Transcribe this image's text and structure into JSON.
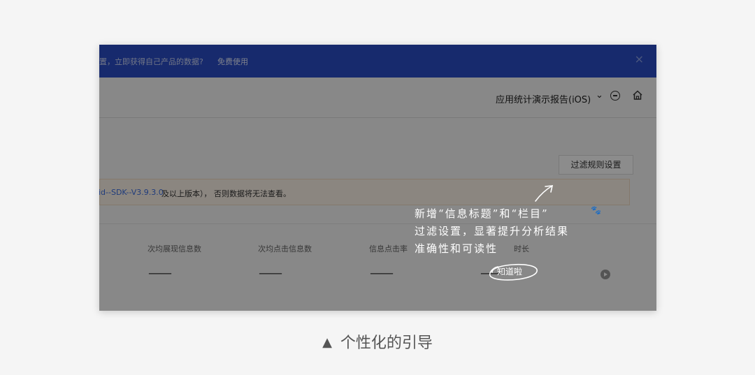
{
  "banner": {
    "text": "置，立即获得自己产品的数据?",
    "link_label": "免费使用",
    "close_label": "×"
  },
  "header": {
    "report_title": "应用统计演示报告(iOS)",
    "chevron": "⌄"
  },
  "filter": {
    "button_label": "过滤规则设置"
  },
  "notice": {
    "link_text": "id--SDK--V3.9.3.0",
    "text": "及以上版本）， 否则数据将无法查看。"
  },
  "stats": {
    "items": [
      {
        "label": "次均展现信息数",
        "value": "——"
      },
      {
        "label": "次均点击信息数",
        "value": "——"
      },
      {
        "label": "信息点击率",
        "value": "——"
      },
      {
        "label": "时长",
        "value": "——"
      }
    ]
  },
  "tip": {
    "line1": "新增“信息标题”和“栏目”",
    "line2": "过滤设置，显著提升分析结果",
    "line3": "准确性和可读性",
    "paw": "🐾",
    "ok_label": "知道啦"
  },
  "caption": {
    "triangle": "▲",
    "text": "个性化的引导"
  },
  "colors": {
    "banner": "#2a4ec7",
    "link": "#3b6de0",
    "overlay": "rgba(0,0,0,0.45)",
    "page_bg": "#f5f5f5"
  }
}
